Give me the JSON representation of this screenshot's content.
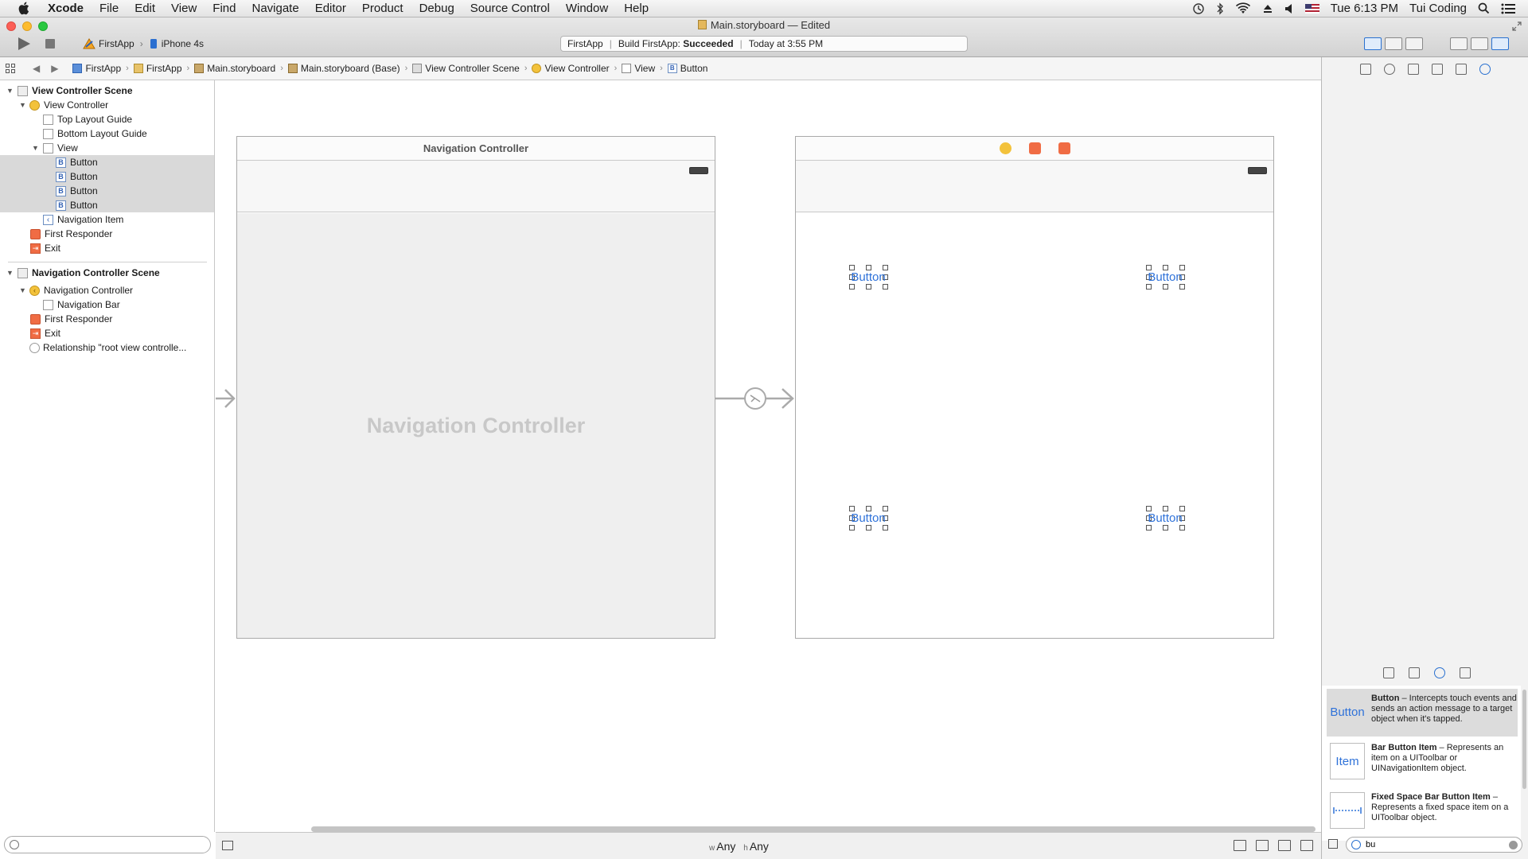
{
  "menubar": {
    "app_name": "Xcode",
    "items": [
      "File",
      "Edit",
      "View",
      "Find",
      "Navigate",
      "Editor",
      "Product",
      "Debug",
      "Source Control",
      "Window",
      "Help"
    ],
    "clock": "Tue 6:13 PM",
    "user": "Tui Coding"
  },
  "window": {
    "title": "Main.storyboard — Edited"
  },
  "toolbar": {
    "scheme": "FirstApp",
    "device": "iPhone 4s",
    "activity_project": "FirstApp",
    "activity_status_prefix": "Build FirstApp:",
    "activity_status": "Succeeded",
    "activity_time": "Today at 3:55 PM"
  },
  "jumpbar": {
    "crumbs": [
      "FirstApp",
      "FirstApp",
      "Main.storyboard",
      "Main.storyboard (Base)",
      "View Controller Scene",
      "View Controller",
      "View",
      "Button"
    ]
  },
  "outline": {
    "vc_scene": "View Controller Scene",
    "vc": "View Controller",
    "top_guide": "Top Layout Guide",
    "bottom_guide": "Bottom Layout Guide",
    "view": "View",
    "buttons": [
      "Button",
      "Button",
      "Button",
      "Button"
    ],
    "nav_item": "Navigation Item",
    "first_responder": "First Responder",
    "exit": "Exit",
    "nc_scene": "Navigation Controller Scene",
    "nc": "Navigation Controller",
    "nav_bar": "Navigation Bar",
    "nc_first_responder": "First Responder",
    "nc_exit": "Exit",
    "relationship": "Relationship \"root view controlle..."
  },
  "canvas": {
    "nav_scene_title": "Navigation Controller",
    "nav_scene_placeholder": "Navigation Controller",
    "buttons": [
      "Button",
      "Button",
      "Button",
      "Button"
    ],
    "size_class_w_prefix": "w",
    "size_class_w": "Any",
    "size_class_h_prefix": "h",
    "size_class_h": "Any"
  },
  "library": {
    "items": [
      {
        "thumb": "Button",
        "name": "Button",
        "desc": " – Intercepts touch events and sends an action message to a target object when it's tapped."
      },
      {
        "thumb": "Item",
        "name": "Bar Button Item",
        "desc": " – Represents an item on a UIToolbar or UINavigationItem object."
      },
      {
        "thumb": "",
        "name": "Fixed Space Bar Button Item",
        "desc": " – Represents a fixed space item on a UIToolbar object."
      }
    ],
    "filter_value": "bu"
  }
}
